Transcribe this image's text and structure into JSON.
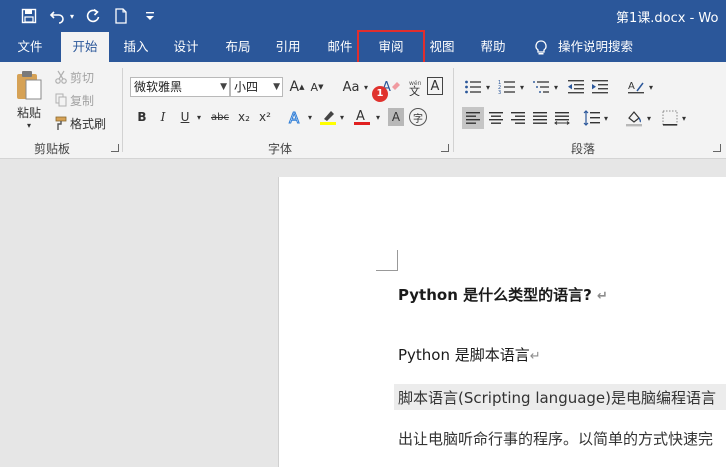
{
  "window": {
    "doc_title": "第1课.docx  -  Wo"
  },
  "quick_access": {
    "save_icon": "save-icon",
    "undo_icon": "undo-icon",
    "redo_icon": "redo-icon",
    "new_icon": "new-doc-icon",
    "customize_icon": "customize-icon"
  },
  "tabs": [
    {
      "label": "文件"
    },
    {
      "label": "开始",
      "active": true
    },
    {
      "label": "插入"
    },
    {
      "label": "设计"
    },
    {
      "label": "布局"
    },
    {
      "label": "引用"
    },
    {
      "label": "邮件"
    },
    {
      "label": "审阅",
      "highlighted": true
    },
    {
      "label": "视图"
    },
    {
      "label": "帮助"
    },
    {
      "label": "操作说明搜索"
    }
  ],
  "clipboard": {
    "paste": "粘贴",
    "cut": "剪切",
    "copy": "复制",
    "format_painter": "格式刷",
    "group_label": "剪贴板"
  },
  "font": {
    "font_name": "微软雅黑",
    "font_size": "小四",
    "change_case": "Aa",
    "bold": "B",
    "italic": "I",
    "underline": "U",
    "strike": "abc",
    "subscript": "x₂",
    "superscript": "x²",
    "char_border": "A",
    "char_shading": "A",
    "enclose": "字",
    "group_label": "字体"
  },
  "paragraph": {
    "group_label": "段落"
  },
  "annotation": {
    "badge": "1"
  },
  "document": {
    "heading": "Python  是什么类型的语言?",
    "line2": "Python 是脚本语言",
    "line3": "脚本语言(Scripting language)是电脑编程语言",
    "line4": "出让电脑听命行事的程序。以简单的方式快速完",
    "para_mark": "↵"
  },
  "colors": {
    "brand": "#2b579a",
    "highlight_box": "#e02e2e",
    "badge": "#e0322d",
    "font_color_bar": "#e02020",
    "highlighter_bar": "#ffff00"
  }
}
